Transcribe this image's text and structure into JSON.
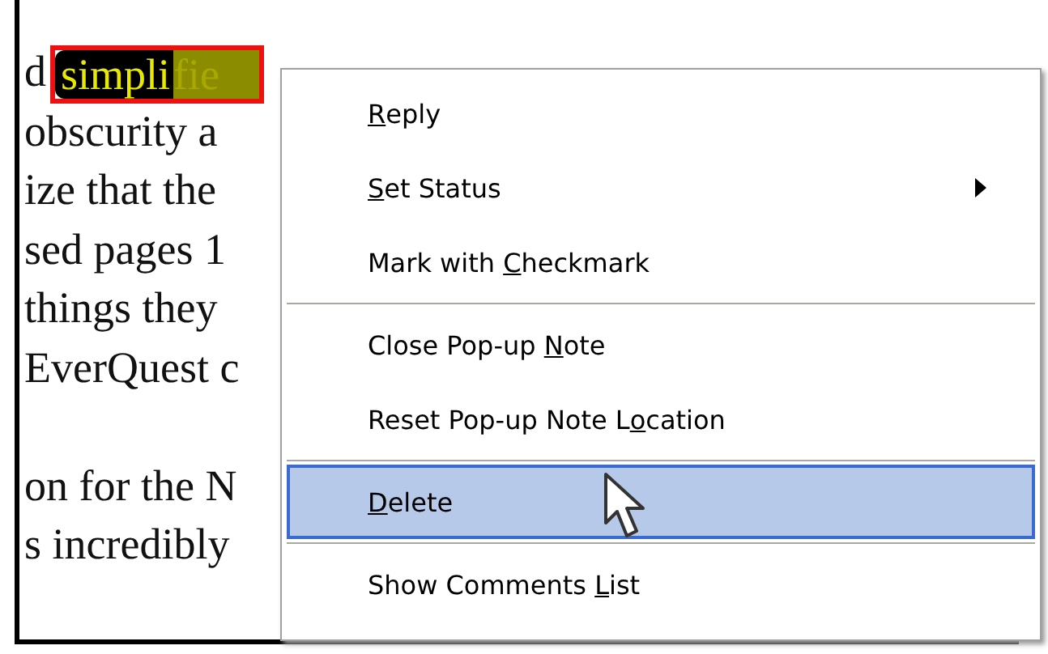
{
  "document": {
    "lines": [
      {
        "kind": "text",
        "text": "d",
        "highlight": {
          "selected_part": "simpli",
          "rest": "fie"
        }
      },
      {
        "kind": "text",
        "text": "obscurity a"
      },
      {
        "kind": "text",
        "text": "ize that the"
      },
      {
        "kind": "text",
        "text": "sed pages 1"
      },
      {
        "kind": "text",
        "text": "things they"
      },
      {
        "kind": "text",
        "text": "EverQuest c"
      },
      {
        "kind": "blank"
      },
      {
        "kind": "text",
        "text": "on for the N"
      },
      {
        "kind": "text",
        "text": "s incredibly"
      }
    ]
  },
  "context_menu": {
    "items": [
      {
        "kind": "item",
        "key": "R",
        "after": "eply",
        "submenu": false,
        "selected": false
      },
      {
        "kind": "item",
        "key": "S",
        "after": "et Status",
        "submenu": true,
        "selected": false
      },
      {
        "kind": "item",
        "before": "Mark with ",
        "key": "C",
        "after": "heckmark",
        "submenu": false,
        "selected": false
      },
      {
        "kind": "separator"
      },
      {
        "kind": "item",
        "before": "Close Pop-up ",
        "key": "N",
        "after": "ote",
        "submenu": false,
        "selected": false
      },
      {
        "kind": "item",
        "before": "Reset Pop-up Note L",
        "key": "o",
        "after": "cation",
        "submenu": false,
        "selected": false
      },
      {
        "kind": "separator"
      },
      {
        "kind": "item",
        "key": "D",
        "after": "elete",
        "submenu": false,
        "selected": true
      },
      {
        "kind": "separator"
      },
      {
        "kind": "item",
        "before": "Show Comments ",
        "key": "L",
        "after": "ist",
        "submenu": false,
        "selected": false
      }
    ]
  }
}
